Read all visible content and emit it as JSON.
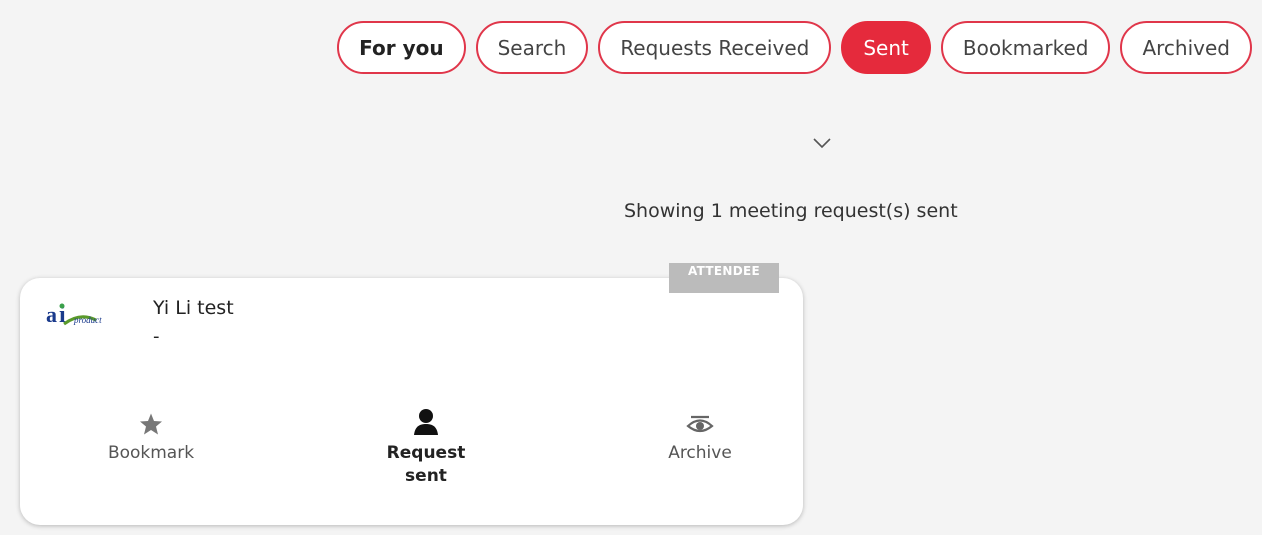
{
  "tabs": [
    {
      "label": "For you"
    },
    {
      "label": "Search"
    },
    {
      "label": "Requests Received"
    },
    {
      "label": "Sent"
    },
    {
      "label": "Bookmarked"
    },
    {
      "label": "Archived"
    }
  ],
  "status_text": "Showing 1 meeting request(s) sent",
  "card": {
    "badge": "ATTENDEE",
    "logo_text": "ai product",
    "name": "Yi Li test",
    "subtitle": "-",
    "actions": {
      "bookmark": {
        "label": "Bookmark",
        "icon": "star-icon"
      },
      "request": {
        "label_line1": "Request",
        "label_line2": "sent",
        "icon": "person-icon"
      },
      "archive": {
        "label": "Archive",
        "icon": "eye-slash-icon"
      }
    }
  },
  "colors": {
    "accent": "#e52a3c",
    "background": "#f4f4f4",
    "badge": "#bbbbbb"
  }
}
